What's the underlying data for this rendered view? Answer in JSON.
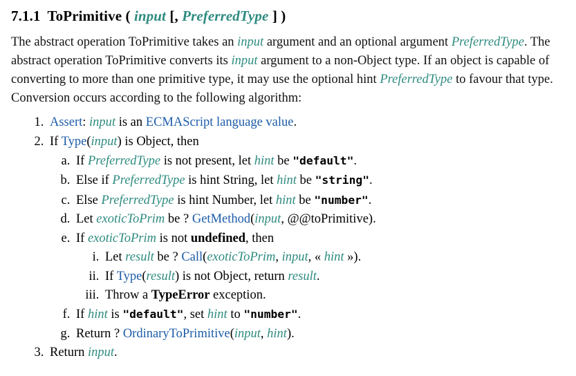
{
  "colors": {
    "variable_teal": "#2e8b80",
    "reference_blue": "#1c5ca8",
    "text_black": "#111111",
    "background": "#ffffff"
  },
  "heading": {
    "section_number": "7.1.1",
    "name": "ToPrimitive",
    "open_paren": "(",
    "param_input": "input",
    "open_bracket": "[",
    "comma": ",",
    "param_preferredtype": "PreferredType",
    "close_bracket": "]",
    "close_paren": ")"
  },
  "paragraph": {
    "s1": "The abstract operation ToPrimitive takes an ",
    "v1": "input",
    "s2": " argument and an optional argument ",
    "v2": "PreferredType",
    "s3": ". The abstract operation ToPrimitive converts its ",
    "v3": "input",
    "s4": " argument to a non-Object type. If an object is capable of converting to more than one primitive type, it may use the optional hint ",
    "v4": "PreferredType",
    "s5": " to favour that type. Conversion occurs according to the following algorithm:"
  },
  "algorithm": {
    "step1": {
      "assert": "Assert",
      "colon": ": ",
      "input": "input",
      "mid": " is an ",
      "ecmascript_language_value": "ECMAScript language value",
      "end": "."
    },
    "step2": {
      "if": "If ",
      "type": "Type",
      "open": "(",
      "input": "input",
      "close": ")",
      "tail": " is Object, then"
    },
    "step2a": {
      "if": "If ",
      "preferredtype": "PreferredType",
      "mid": " is not present, let ",
      "hint": "hint",
      "be": " be ",
      "literal": "\"default\"",
      "end": "."
    },
    "step2b": {
      "if": "Else if ",
      "preferredtype": "PreferredType",
      "mid": " is hint String, let ",
      "hint": "hint",
      "be": " be ",
      "literal": "\"string\"",
      "end": "."
    },
    "step2c": {
      "if": "Else ",
      "preferredtype": "PreferredType",
      "mid": " is hint Number, let ",
      "hint": "hint",
      "be": " be ",
      "literal": "\"number\"",
      "end": "."
    },
    "step2d": {
      "let": "Let ",
      "exotictoprim": "exoticToPrim",
      "be": " be ? ",
      "getmethod": "GetMethod",
      "open": "(",
      "input": "input",
      "comma": ", ",
      "symbol": "@@toPrimitive",
      "close": ")",
      "end": "."
    },
    "step2e": {
      "if": "If ",
      "exotictoprim": "exoticToPrim",
      "mid": " is ",
      "not": "not ",
      "undefined": "undefined",
      "tail": ", then"
    },
    "step2ei": {
      "let": "Let ",
      "result": "result",
      "be": " be ? ",
      "call": "Call",
      "open": "(",
      "exotictoprim": "exoticToPrim",
      "comma1": ", ",
      "input": "input",
      "comma2": ", ",
      "guillemet_open": "« ",
      "hint": "hint",
      "guillemet_close": " »",
      "close": ")",
      "end": "."
    },
    "step2eii": {
      "if": "If ",
      "type": "Type",
      "open": "(",
      "result": "result",
      "close": ")",
      "mid": " is not Object, return ",
      "result2": "result",
      "end": "."
    },
    "step2eiii": {
      "throw": "Throw a ",
      "typeerror": "TypeError",
      "end": " exception."
    },
    "step2f": {
      "if": "If ",
      "hint": "hint",
      "is": " is ",
      "literal1": "\"default\"",
      "set": ", set ",
      "hint2": "hint",
      "to": " to ",
      "literal2": "\"number\"",
      "end": "."
    },
    "step2g": {
      "return": "Return ? ",
      "ordinarytoprimitive": "OrdinaryToPrimitive",
      "open": "(",
      "input": "input",
      "comma": ", ",
      "hint": "hint",
      "close": ")",
      "end": "."
    },
    "step3": {
      "return": "Return ",
      "input": "input",
      "end": "."
    }
  }
}
